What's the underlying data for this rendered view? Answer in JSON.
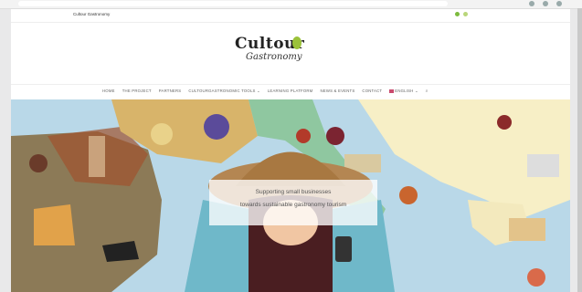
{
  "site_name": "Cultour Gastronomy",
  "logo": {
    "word": "Cultour",
    "sub": "Gastronomy"
  },
  "nav": {
    "home": "HOME",
    "project": "THE PROJECT",
    "partners": "PARTNERS",
    "tools": "CULTOURGASTRONOMIC TOOLS",
    "learning": "LEARNING PLATFORM",
    "news": "NEWS & EVENTS",
    "contact": "CONTACT",
    "language": "ENGLISH"
  },
  "hero": {
    "line1": "Supporting small businesses",
    "line2": "towards sustainable gastronomy tourism"
  },
  "colors": {
    "accent": "#9bc23a",
    "sea": "#b9d8e8"
  }
}
